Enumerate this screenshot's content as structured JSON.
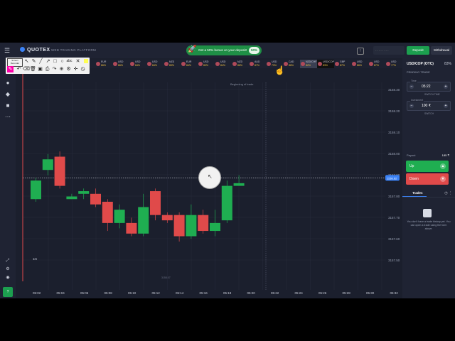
{
  "header": {
    "brand": "QUOTEX",
    "platform": "WEB TRADING PLATFORM",
    "bonus_text": "Get a 50% bonus on your deposit!",
    "bonus_pct": "50%",
    "account_placeholder": "- - - - - - - -",
    "deposit_label": "Deposit",
    "withdraw_label": "Withdrawal"
  },
  "asset_tabs": [
    {
      "name": "EUR",
      "pct": "86%"
    },
    {
      "name": "USD",
      "pct": "86%"
    },
    {
      "name": "USD",
      "pct": "84%"
    },
    {
      "name": "USD",
      "pct": "84%"
    },
    {
      "name": "NZD",
      "pct": "89%"
    },
    {
      "name": "EUR",
      "pct": "84%"
    },
    {
      "name": "USD",
      "pct": "80%"
    },
    {
      "name": "USD",
      "pct": "84%"
    },
    {
      "name": "NZD",
      "pct": "86%"
    },
    {
      "name": "AUD",
      "pct": "87%"
    },
    {
      "name": "USD",
      "pct": "79%"
    },
    {
      "name": "CAD",
      "pct": "86%"
    },
    {
      "name": "NZD/CHF",
      "pct": "82%"
    },
    {
      "name": "USD/COP",
      "pct": "83%"
    },
    {
      "name": "GBP",
      "pct": "87%"
    },
    {
      "name": "USD",
      "pct": "86%"
    },
    {
      "name": "USD",
      "pct": "87%"
    },
    {
      "name": "USD",
      "pct": "77%"
    }
  ],
  "chart": {
    "beginning_label": "Beginning of trade",
    "current_price_label": "1158.62",
    "y_ticks": [
      "3158.30",
      "3158.20",
      "3158.10",
      "3158.00",
      "3157.90",
      "3157.80",
      "3157.70",
      "3157.60",
      "3157.50"
    ],
    "x_ticks": [
      "05:02",
      "05:04",
      "05:06",
      "05:08",
      "05:10",
      "05:12",
      "05:14",
      "05:16",
      "05:18",
      "05:20",
      "05:22",
      "05:24",
      "05:26",
      "05:28",
      "05:30",
      "05:32"
    ],
    "timeframe": "1m",
    "candles": [
      {
        "o": 3157.86,
        "c": 3157.93,
        "h": 3157.94,
        "l": 3157.85
      },
      {
        "o": 3157.97,
        "c": 3158.01,
        "h": 3158.03,
        "l": 3157.95
      },
      {
        "o": 3158.02,
        "c": 3157.91,
        "h": 3158.04,
        "l": 3157.9
      },
      {
        "o": 3157.86,
        "c": 3157.87,
        "h": 3157.88,
        "l": 3157.86
      },
      {
        "o": 3157.88,
        "c": 3157.89,
        "h": 3157.9,
        "l": 3157.86
      },
      {
        "o": 3157.88,
        "c": 3157.84,
        "h": 3157.9,
        "l": 3157.83
      },
      {
        "o": 3157.85,
        "c": 3157.77,
        "h": 3157.86,
        "l": 3157.74
      },
      {
        "o": 3157.77,
        "c": 3157.82,
        "h": 3157.84,
        "l": 3157.75
      },
      {
        "o": 3157.77,
        "c": 3157.73,
        "h": 3157.79,
        "l": 3157.72
      },
      {
        "o": 3157.73,
        "c": 3157.83,
        "h": 3157.88,
        "l": 3157.72
      },
      {
        "o": 3157.89,
        "c": 3157.8,
        "h": 3157.9,
        "l": 3157.78
      },
      {
        "o": 3157.8,
        "c": 3157.78,
        "h": 3157.81,
        "l": 3157.77
      },
      {
        "o": 3157.8,
        "c": 3157.72,
        "h": 3157.81,
        "l": 3157.7
      },
      {
        "o": 3157.72,
        "c": 3157.8,
        "h": 3157.84,
        "l": 3157.71
      },
      {
        "o": 3157.8,
        "c": 3157.74,
        "h": 3157.82,
        "l": 3157.73
      },
      {
        "o": 3157.74,
        "c": 3157.77,
        "h": 3157.82,
        "l": 3157.72
      },
      {
        "o": 3157.78,
        "c": 3157.91,
        "h": 3157.93,
        "l": 3157.77
      },
      {
        "o": 3157.91,
        "c": 3157.92,
        "h": 3157.95,
        "l": 3157.91
      }
    ],
    "bottom_value_label": "3158.07"
  },
  "trade_panel": {
    "pair": "USD/COP (OTC)",
    "pair_pct": "83%",
    "pending_label": "PENDING TRADE",
    "time_label": "Time",
    "time_value": "05:22",
    "time_sub": "SWITCH TIME",
    "invest_label": "Investment",
    "invest_value": "100 ₹",
    "invest_sub": "SWITCH",
    "payout_label": "Payout",
    "payout_value": "185 ₹",
    "up_label": "Up",
    "down_label": "Down",
    "trades_tab": "Trades",
    "empty_text": "You don't have a trade history yet. You can open a trade using the form above."
  },
  "colors": {
    "up": "#1fae51",
    "down": "#e04a4a",
    "bg": "#1b1f2d"
  }
}
